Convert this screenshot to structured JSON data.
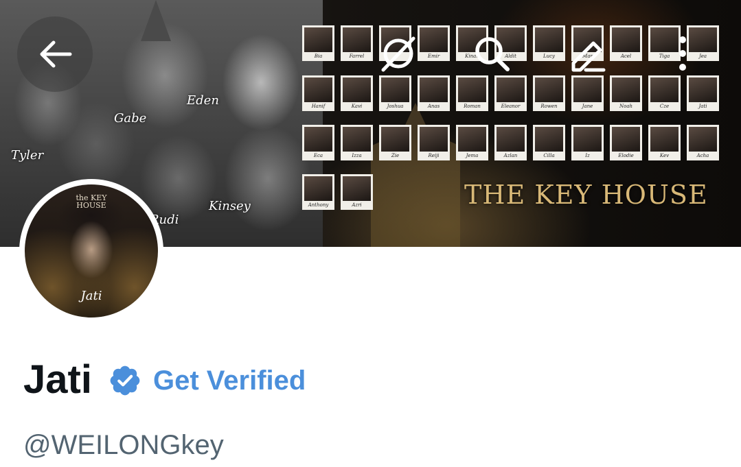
{
  "header": {
    "back_icon": "arrow-left-icon",
    "action_icons": [
      "no-retweets-icon",
      "search-icon",
      "edit-icon",
      "more-vertical-icon"
    ]
  },
  "banner": {
    "cast_labels": [
      "Tyler",
      "Gabe",
      "Eden",
      "Rudi",
      "Kinsey"
    ],
    "title": "THE KEY HOUSE",
    "grid": [
      [
        "Bia",
        "Farrel",
        "",
        "Emir",
        "Kinan",
        "Aldit",
        "Lucy",
        "Mar",
        "Acel",
        "Tiga",
        "Jea"
      ],
      [
        "Hanif",
        "Kavi",
        "Joshua",
        "Anas",
        "Roman",
        "Eleanor",
        "Rowen",
        "Jane",
        "Noah",
        "Cze",
        "Jati"
      ],
      [
        "Eca",
        "Izza",
        "Zie",
        "Reiji",
        "Jema",
        "Azlan",
        "Cilla",
        "Iz",
        "Elodie",
        "Kev",
        "Acha"
      ],
      [
        "Anthony",
        "Azri"
      ]
    ]
  },
  "avatar": {
    "logo_top": "the KEY",
    "logo_bottom": "HOUSE",
    "name": "Jati"
  },
  "profile": {
    "display_name": "Jati",
    "verified_icon": "verified-badge-icon",
    "get_verified_label": "Get Verified",
    "handle": "@WEILONGkey"
  },
  "colors": {
    "accent_blue": "#4b8fdb",
    "name_text": "#0f1419",
    "handle_text": "#536471"
  }
}
